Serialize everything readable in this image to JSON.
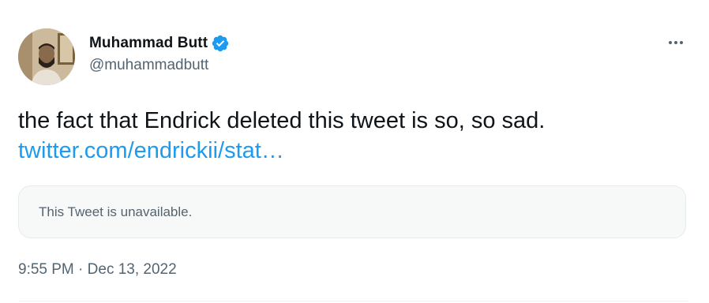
{
  "author": {
    "display_name": "Muhammad Butt",
    "handle": "@muhammadbutt",
    "verified": true
  },
  "tweet": {
    "text": "the fact that Endrick deleted this tweet is so, so sad.",
    "link_text": "twitter.com/endrickii/stat…",
    "quoted": {
      "unavailable_text": "This Tweet is unavailable."
    },
    "time": "9:55 PM",
    "separator": "·",
    "date": "Dec 13, 2022"
  },
  "icons": {
    "verified": "verified-badge-icon",
    "more": "more-options-icon"
  },
  "colors": {
    "link": "#1d9bf0",
    "verified": "#1d9bf0",
    "secondary_text": "#536471",
    "primary_text": "#0f1419",
    "card_background": "#f7f9f9"
  }
}
